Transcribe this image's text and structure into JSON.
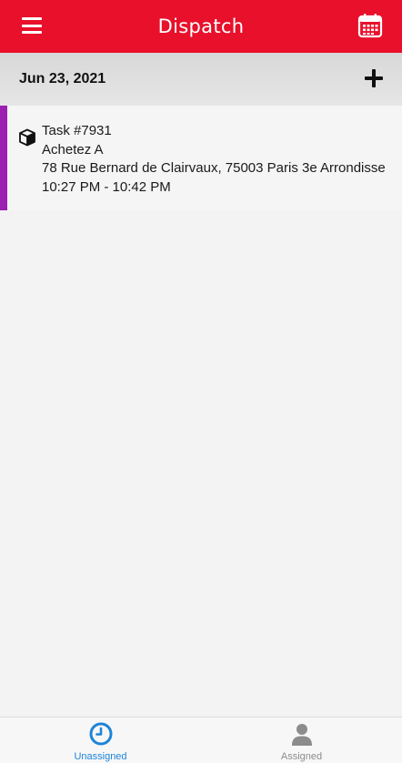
{
  "header": {
    "title": "Dispatch",
    "menu_icon": "hamburger-menu-icon",
    "calendar_icon": "calendar-icon",
    "background_color": "#e8102b"
  },
  "date_bar": {
    "date": "Jun 23, 2021",
    "add_icon": "plus-icon"
  },
  "tasks": [
    {
      "icon": "box-icon",
      "accent_color": "#9b1fb0",
      "task_id": "Task #7931",
      "name": "Achetez A",
      "address": "78 Rue Bernard de Clairvaux, 75003 Paris 3e Arrondisse",
      "time_range": "10:27 PM - 10:42 PM"
    }
  ],
  "bottom_nav": {
    "tabs": [
      {
        "label": "Unassigned",
        "icon": "clock-icon",
        "active": true,
        "color": "#1e84d8"
      },
      {
        "label": "Assigned",
        "icon": "person-icon",
        "active": false,
        "color": "#8c8c8c"
      }
    ]
  }
}
